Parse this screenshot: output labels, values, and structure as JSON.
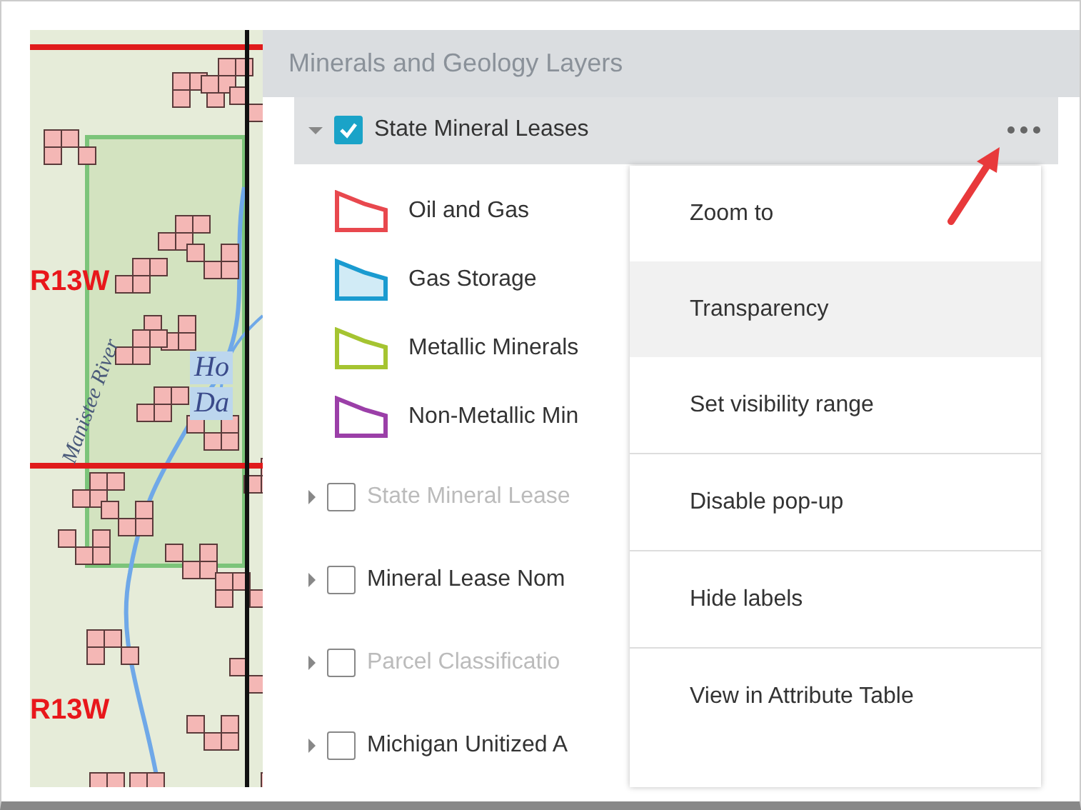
{
  "map": {
    "labels": [
      {
        "text": "R13W",
        "kind": "range"
      },
      {
        "text": "Ho",
        "kind": "water"
      },
      {
        "text": "Da",
        "kind": "water"
      },
      {
        "text": "Manistee River",
        "kind": "river"
      },
      {
        "text": "R13W",
        "kind": "range"
      }
    ]
  },
  "panel": {
    "title": "Minerals and Geology Layers"
  },
  "layers": [
    {
      "label": "State Mineral Leases",
      "checked": true,
      "expanded": true,
      "disabled": false,
      "legend": [
        {
          "label": "Oil and Gas",
          "color": "#e8484e",
          "filled": false
        },
        {
          "label": "Gas Storage",
          "color": "#1a9bd0",
          "filled": true
        },
        {
          "label": "Metallic Minerals",
          "color": "#a5c431",
          "filled": false
        },
        {
          "label": "Non-Metallic Min",
          "color": "#9b3fa8",
          "filled": false
        }
      ]
    },
    {
      "label": "State Mineral Lease",
      "checked": false,
      "expanded": false,
      "disabled": true
    },
    {
      "label": "Mineral Lease Nom",
      "checked": false,
      "expanded": false,
      "disabled": false
    },
    {
      "label": "Parcel Classificatio",
      "checked": false,
      "expanded": false,
      "disabled": true
    },
    {
      "label": "Michigan Unitized A",
      "checked": false,
      "expanded": false,
      "disabled": false
    }
  ],
  "menu": {
    "items": [
      {
        "label": "Zoom to",
        "selected": false,
        "separated": false
      },
      {
        "label": "Transparency",
        "selected": true,
        "separated": false
      },
      {
        "label": "Set visibility range",
        "selected": false,
        "separated": false
      },
      {
        "label": "Disable pop-up",
        "selected": false,
        "separated": true
      },
      {
        "label": "Hide labels",
        "selected": false,
        "separated": true
      },
      {
        "label": "View in Attribute Table",
        "selected": false,
        "separated": true
      }
    ]
  }
}
